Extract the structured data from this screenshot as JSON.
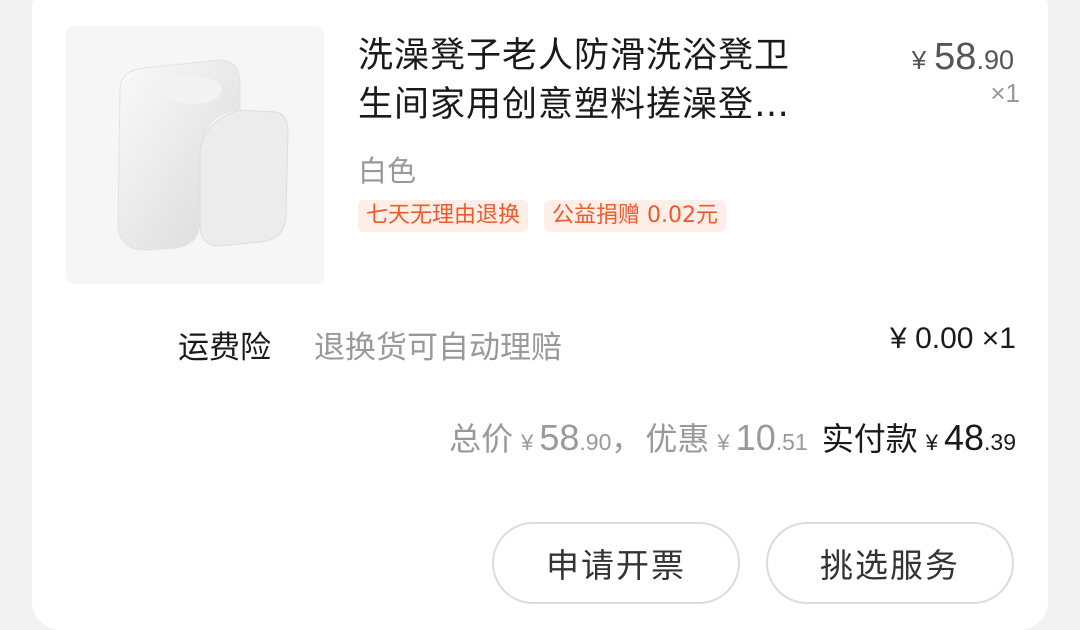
{
  "product": {
    "image_icon": "stool-image",
    "title_line1": "洗澡凳子老人防滑洗浴凳卫",
    "title_line2": "生间家用创意塑料搓澡登…",
    "price_symbol": "¥",
    "price_int": "58",
    "price_dec": ".90",
    "quantity": "×1",
    "variant": "白色",
    "tags": [
      "七天无理由退换",
      "公益捐赠 0.02元"
    ]
  },
  "insurance": {
    "name": "运费险",
    "description": "退换货可自动理赔",
    "price": "¥ 0.00 ×1"
  },
  "totals": {
    "total_label": "总价",
    "total_symbol": "¥",
    "total_int": "58",
    "total_dec": ".90",
    "comma": "，",
    "discount_label": "优惠",
    "discount_symbol": "¥",
    "discount_int": "10",
    "discount_dec": ".51",
    "paid_label": "实付款",
    "paid_symbol": "¥",
    "paid_int": "48",
    "paid_dec": ".39"
  },
  "actions": {
    "invoice": "申请开票",
    "service": "挑选服务"
  },
  "colors": {
    "tag_bg": "#fdeee8",
    "tag_text": "#ee5a2c",
    "card_bg": "#ffffff",
    "page_bg": "#f2f2f2"
  }
}
